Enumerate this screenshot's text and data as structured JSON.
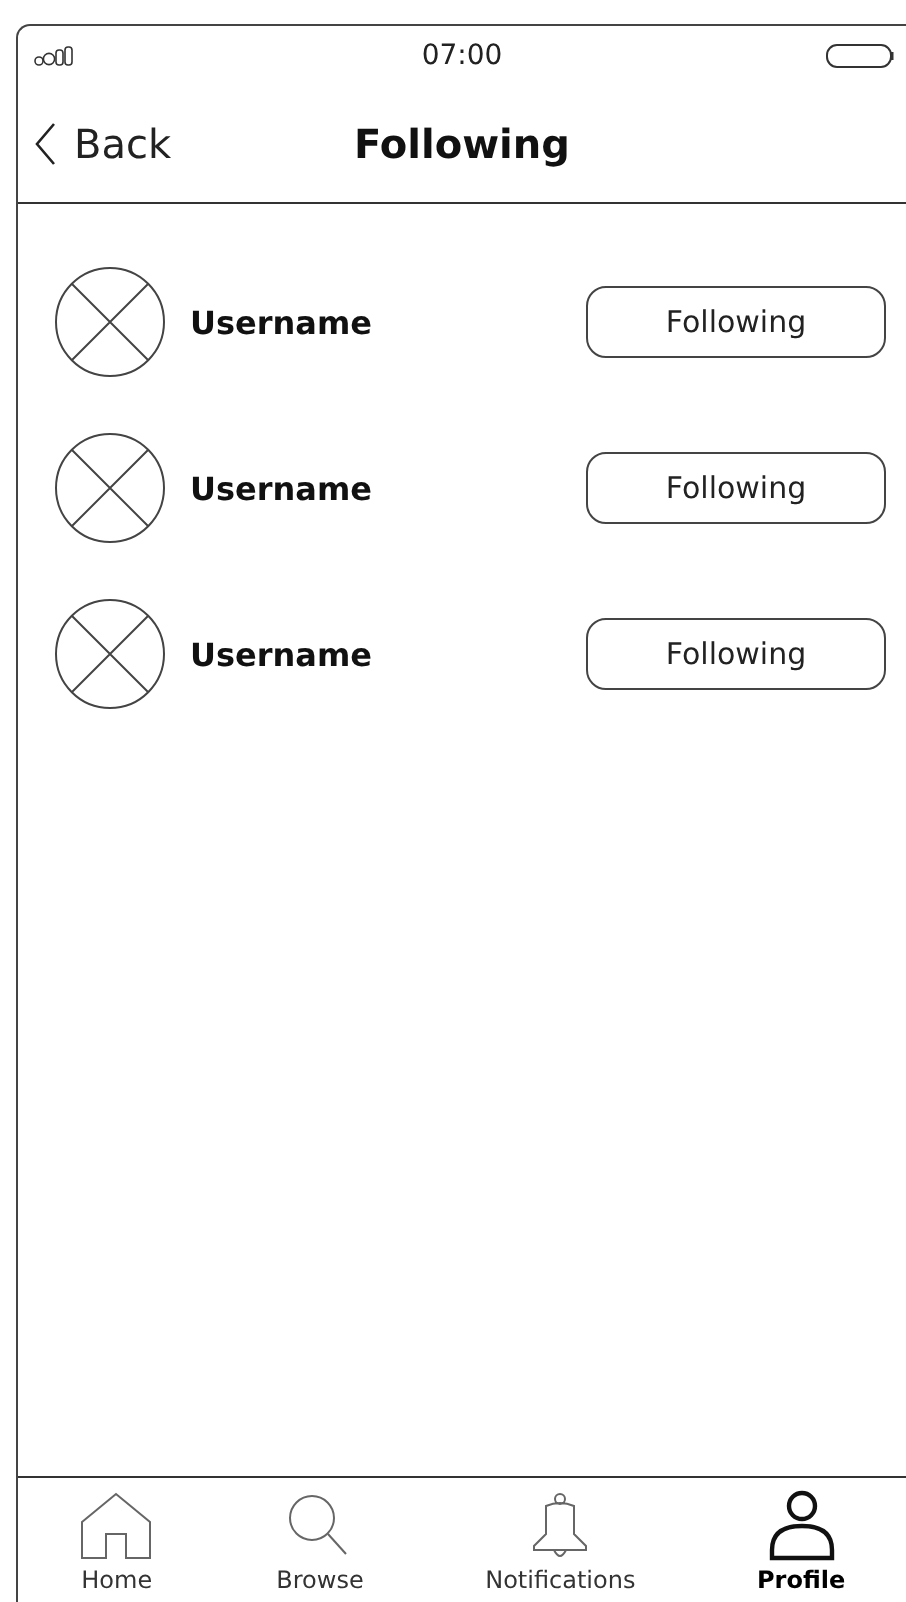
{
  "status_bar": {
    "time": "07:00"
  },
  "header": {
    "back": "Back",
    "title": "Following"
  },
  "users": [
    {
      "name": "Username",
      "button": "Following"
    },
    {
      "name": "Username",
      "button": "Following"
    },
    {
      "name": "Username",
      "button": "Following"
    }
  ],
  "tab_bar": [
    {
      "label": "Home",
      "kind": "home",
      "selected": false
    },
    {
      "label": "Browse",
      "kind": "search",
      "selected": false
    },
    {
      "label": "Notifications",
      "kind": "bell",
      "selected": false
    },
    {
      "label": "Profile",
      "kind": "person",
      "selected": true
    }
  ]
}
